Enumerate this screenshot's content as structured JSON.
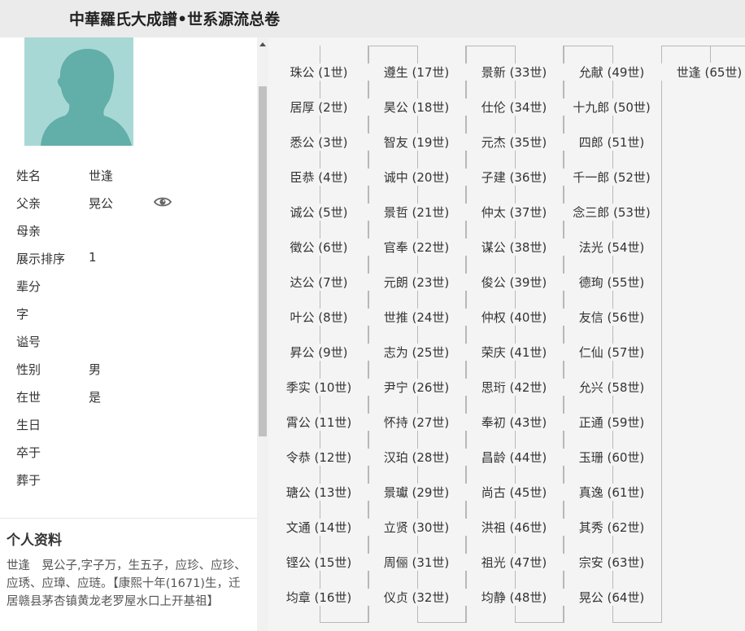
{
  "header": {
    "title": "中華羅氏大成譜•世系源流总卷"
  },
  "profile": {
    "fields": [
      {
        "label": "姓名",
        "value": "世逢"
      },
      {
        "label": "父亲",
        "value": "晃公",
        "has_eye_icon": true
      },
      {
        "label": "母亲",
        "value": ""
      },
      {
        "label": "展示排序",
        "value": "1"
      },
      {
        "label": "辈分",
        "value": ""
      },
      {
        "label": "字",
        "value": ""
      },
      {
        "label": "谥号",
        "value": ""
      },
      {
        "label": "性别",
        "value": "男"
      },
      {
        "label": "在世",
        "value": "是"
      },
      {
        "label": "生日",
        "value": ""
      },
      {
        "label": "卒于",
        "value": ""
      },
      {
        "label": "葬于",
        "value": ""
      }
    ],
    "bio_title": "个人资料",
    "bio_text": "世逢　晃公子,字子万，生五子，应珍、应珍、应琇、应璋、应琏。【康熙十年(1671)生，迁居赣县茅杏镇黄龙老罗屋水口上开基祖】"
  },
  "lineage": {
    "columns": [
      [
        "珠公 (1世)",
        "居厚 (2世)",
        "悉公 (3世)",
        "臣恭 (4世)",
        "诚公 (5世)",
        "徵公 (6世)",
        "达公 (7世)",
        "叶公 (8世)",
        "昇公 (9世)",
        "季实 (10世)",
        "霄公 (11世)",
        "令恭 (12世)",
        "瑭公 (13世)",
        "文通 (14世)",
        "铿公 (15世)",
        "均章 (16世)"
      ],
      [
        "遵生 (17世)",
        "昊公 (18世)",
        "智友 (19世)",
        "诚中 (20世)",
        "景哲 (21世)",
        "官奉 (22世)",
        "元朗 (23世)",
        "世推 (24世)",
        "志为 (25世)",
        "尹宁 (26世)",
        "怀持 (27世)",
        "汉珀 (28世)",
        "景瓛 (29世)",
        "立贤 (30世)",
        "周俪 (31世)",
        "仪贞 (32世)"
      ],
      [
        "景新 (33世)",
        "仕伦 (34世)",
        "元杰 (35世)",
        "子建 (36世)",
        "仲太 (37世)",
        "谋公 (38世)",
        "俊公 (39世)",
        "仲权 (40世)",
        "荣庆 (41世)",
        "思珩 (42世)",
        "奉初 (43世)",
        "昌龄 (44世)",
        "尚古 (45世)",
        "洪祖 (46世)",
        "祖光 (47世)",
        "均静 (48世)"
      ],
      [
        "允献 (49世)",
        "十九郎 (50世)",
        "四郎 (51世)",
        "千一郎 (52世)",
        "念三郎 (53世)",
        "法光 (54世)",
        "德珣 (55世)",
        "友信 (56世)",
        "仁仙 (57世)",
        "允兴 (58世)",
        "正通 (59世)",
        "玉珊 (60世)",
        "真逸 (61世)",
        "其秀 (62世)",
        "宗安 (63世)",
        "晃公 (64世)"
      ],
      [
        "世逢 (65世)"
      ]
    ]
  },
  "colors": {
    "header_bg": "#ebebeb",
    "tree_bg": "#f4f4f4",
    "avatar_bg": "#a8d8d5",
    "avatar_silhouette": "#62aea8"
  }
}
